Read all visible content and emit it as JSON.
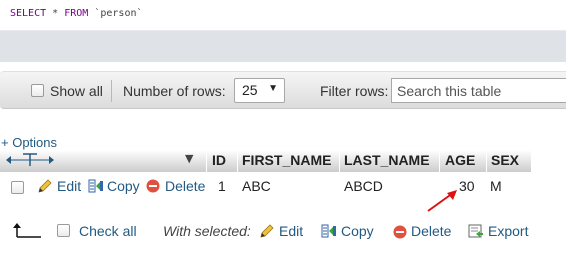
{
  "sql": {
    "keyword_select": "SELECT",
    "star": "*",
    "keyword_from": "FROM",
    "table": "`person`"
  },
  "navbar": {
    "show_all": "Show all",
    "number_of_rows_label": "Number of rows:",
    "rows_value": "25",
    "filter_label": "Filter rows:",
    "search_placeholder": "Search this table"
  },
  "options_link": "+ Options",
  "table": {
    "columns": [
      "ID",
      "FIRST_NAME",
      "LAST_NAME",
      "AGE",
      "SEX"
    ],
    "row_actions": {
      "edit": "Edit",
      "copy": "Copy",
      "delete": "Delete"
    },
    "rows": [
      {
        "ID": "1",
        "FIRST_NAME": "ABC",
        "LAST_NAME": "ABCD",
        "AGE": "30",
        "SEX": "M"
      }
    ]
  },
  "bottom": {
    "check_all": "Check all",
    "with_selected": "With selected:",
    "edit": "Edit",
    "copy": "Copy",
    "delete": "Delete",
    "export": "Export"
  },
  "colors": {
    "link": "#235a81",
    "keyword": "#770088",
    "annotation_arrow": "#dd1111"
  }
}
